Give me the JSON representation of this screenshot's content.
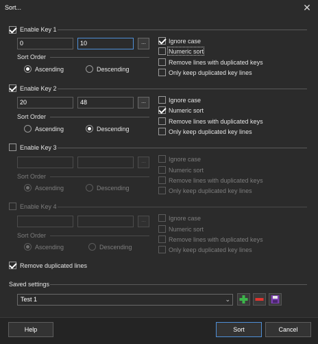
{
  "window": {
    "title": "Sort...",
    "close_glyph": "✕"
  },
  "key1": {
    "enable_label": "Enable Key 1",
    "enabled": true,
    "start": "0",
    "end": "10",
    "browse": "...",
    "sort_order_label": "Sort Order",
    "ascending_label": "Ascending",
    "descending_label": "Descending",
    "order": "ascending",
    "options": [
      {
        "label": "Ignore case",
        "checked": true
      },
      {
        "label": "Numeric sort",
        "checked": false
      },
      {
        "label": "Remove lines with duplicated keys",
        "checked": false
      },
      {
        "label": "Only keep duplicated key lines",
        "checked": false
      }
    ]
  },
  "key2": {
    "enable_label": "Enable Key 2",
    "enabled": true,
    "start": "20",
    "end": "48",
    "browse": "...",
    "sort_order_label": "Sort Order",
    "ascending_label": "Ascending",
    "descending_label": "Descending",
    "order": "descending",
    "options": [
      {
        "label": "Ignore case",
        "checked": false
      },
      {
        "label": "Numeric sort",
        "checked": true
      },
      {
        "label": "Remove lines with duplicated keys",
        "checked": false
      },
      {
        "label": "Only keep duplicated key lines",
        "checked": false
      }
    ]
  },
  "key3": {
    "enable_label": "Enable Key 3",
    "enabled": false,
    "start": "",
    "end": "",
    "browse": "...",
    "sort_order_label": "Sort Order",
    "ascending_label": "Ascending",
    "descending_label": "Descending",
    "order": "ascending",
    "options": [
      {
        "label": "Ignore case",
        "checked": false
      },
      {
        "label": "Numeric sort",
        "checked": false
      },
      {
        "label": "Remove lines with duplicated keys",
        "checked": false
      },
      {
        "label": "Only keep duplicated key lines",
        "checked": false
      }
    ]
  },
  "key4": {
    "enable_label": "Enable Key 4",
    "enabled": false,
    "start": "",
    "end": "",
    "browse": "...",
    "sort_order_label": "Sort Order",
    "ascending_label": "Ascending",
    "descending_label": "Descending",
    "order": "ascending",
    "options": [
      {
        "label": "Ignore case",
        "checked": false
      },
      {
        "label": "Numeric sort",
        "checked": false
      },
      {
        "label": "Remove lines with duplicated keys",
        "checked": false
      },
      {
        "label": "Only keep duplicated key lines",
        "checked": false
      }
    ]
  },
  "remove_duplicated": {
    "label": "Remove duplicated lines",
    "checked": true
  },
  "saved_settings": {
    "label": "Saved settings",
    "selected": "Test 1",
    "add_icon": "plus-icon",
    "remove_icon": "minus-icon",
    "save_icon": "floppy-disk-icon"
  },
  "buttons": {
    "help": "Help",
    "sort": "Sort",
    "cancel": "Cancel"
  },
  "colors": {
    "accent": "#4f90d8",
    "add": "#3cb54a",
    "remove": "#e0342f",
    "save": "#7b3fb0"
  }
}
